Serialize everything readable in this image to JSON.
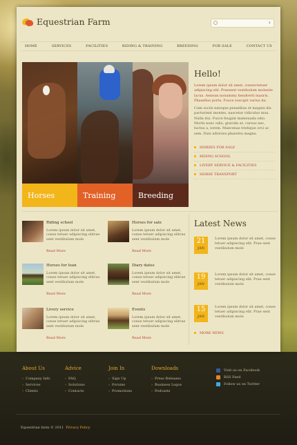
{
  "brand": {
    "name": "Equestrian Farm"
  },
  "search": {
    "placeholder": "",
    "go_label": "›"
  },
  "nav": [
    "HOME",
    "SERVICES",
    "FACILITIES",
    "RIDING & TRAINING",
    "BREEDING",
    "FOR SALE",
    "CONTACT US"
  ],
  "banner": {
    "slices": [
      "Horses",
      "Training",
      "Breeding"
    ]
  },
  "hello": {
    "title": "Hello!",
    "lead": "Lorem ipsum dolor sit amet, consectetuer adipiscing elit. Praesent vestibulum molestie lacus. Aenean nonummy hendrerit mauris. Phasellus porta. Fusce suscipit varius mi.",
    "body": "Cum sociis natoque penatibus et magnis dis parturient montes, nascetur ridiculus mus. Nulla dui. Fusce feugiat malesuada odio. Morbi nunc odio, gravida at, cursus nec, luctus a, lorem. Maecenas tristique orci ac sem. Duis ultricies pharetra magna.",
    "links": [
      "HORSES FOR SALE",
      "RIDING SCHOOL",
      "LIVERY SERVICE & FACILITIES",
      "HORSE TRANSPORT"
    ]
  },
  "features": [
    {
      "title": "Riding school",
      "text": "Lorem ipsum dolor sit amet, conse tetuer adipiscing elitrae sent vestibulum mole",
      "more": "Read More"
    },
    {
      "title": "Horses for sale",
      "text": "Lorem ipsum dolor sit amet, conse tetuer adipiscing elitrae sent vestibulum mole",
      "more": "Read More"
    },
    {
      "title": "Horses for loan",
      "text": "Lorem ipsum dolor sit amet, conse tetuer adipiscing elitrae sent vestibulum mole",
      "more": "Read More"
    },
    {
      "title": "Diary dates",
      "text": "Lorem ipsum dolor sit amet, conse tetuer adipiscing elitrae sent vestibulum mole",
      "more": "Read More"
    },
    {
      "title": "Livery service",
      "text": "Lorem ipsum dolor sit amet, conse tetuer adipiscing elitrae sent vestibulum mole",
      "more": "Read More"
    },
    {
      "title": "Events",
      "text": "Lorem ipsum dolor sit amet, conse tetuer adipiscing elitrae sent vestibulum mole",
      "more": "Read More"
    }
  ],
  "news": {
    "title": "Latest News",
    "items": [
      {
        "day": "21",
        "month": "JAN",
        "text": "Lorem ipsum dolor sit amet, conse tetuer adipiscing elit. Prae sent vestibulum mole"
      },
      {
        "day": "19",
        "month": "JAN",
        "text": "Lorem ipsum dolor sit amet, conse tetuer adipiscing elit. Prae sent vestibulum mole"
      },
      {
        "day": "15",
        "month": "JAN",
        "text": "Lorem ipsum dolor sit amet, conse tetuer adipiscing elit. Prae sent vestibulum mole"
      }
    ],
    "more": "MORE NEWS"
  },
  "footer": {
    "columns": [
      {
        "title": "About Us",
        "items": [
          "Company Info",
          "Services",
          "Clients"
        ]
      },
      {
        "title": "Advice",
        "items": [
          "FAQ",
          "Solutions",
          "Contacts"
        ]
      },
      {
        "title": "Join In",
        "items": [
          "Sign Up",
          "Forums",
          "Promotions"
        ]
      },
      {
        "title": "Downloads",
        "items": [
          "Press Releases",
          "Business Logos",
          "Podcasts"
        ]
      }
    ],
    "social": [
      "Visit us on Facebook",
      "RSS Feed",
      "Follow us on Twitter"
    ],
    "copyright": "Equestrian farm © 2011",
    "privacy": "Privacy Policy"
  },
  "colors": {
    "accent_yellow": "#f2b51a",
    "accent_orange": "#e26127",
    "accent_brown": "#5c2a1a",
    "link_red": "#b6402c"
  }
}
